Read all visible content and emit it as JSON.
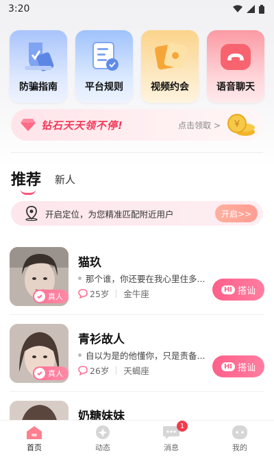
{
  "status_bar": {
    "time": "3:20"
  },
  "quick_actions": [
    {
      "label": "防骗指南",
      "icon": "shield-phone-icon"
    },
    {
      "label": "平台规则",
      "icon": "document-icon"
    },
    {
      "label": "视频约会",
      "icon": "video-cards-icon"
    },
    {
      "label": "语音聊天",
      "icon": "phone-icon"
    }
  ],
  "diamond_banner": {
    "title": "钻石天天领不停!",
    "claim_label": "点击领取 >"
  },
  "tabs": {
    "active": "推荐",
    "other": "新人"
  },
  "location_bar": {
    "text": "开启定位，为您精准匹配附近用户",
    "button": "开启>>"
  },
  "users": [
    {
      "name": "猫玖",
      "signature": "那个谁，你还要在我心里住多...",
      "age": "25岁",
      "zodiac": "金牛座",
      "verified": "真人",
      "hi_label": "HI",
      "action": "搭讪"
    },
    {
      "name": "青衫故人",
      "signature": "自以为是的他懂你，只是责备...",
      "age": "26岁",
      "zodiac": "天蝎座",
      "verified": "真人",
      "hi_label": "HI",
      "action": "搭讪"
    },
    {
      "name": "奶糖妹妹"
    }
  ],
  "bottom_nav": [
    {
      "label": "首页",
      "icon": "home-icon",
      "active": true
    },
    {
      "label": "动态",
      "icon": "moments-icon"
    },
    {
      "label": "消息",
      "icon": "message-icon",
      "badge": "1"
    },
    {
      "label": "我的",
      "icon": "profile-icon"
    }
  ],
  "colors": {
    "accent": "#ff5f8a",
    "banner_text": "#f23a5a"
  }
}
